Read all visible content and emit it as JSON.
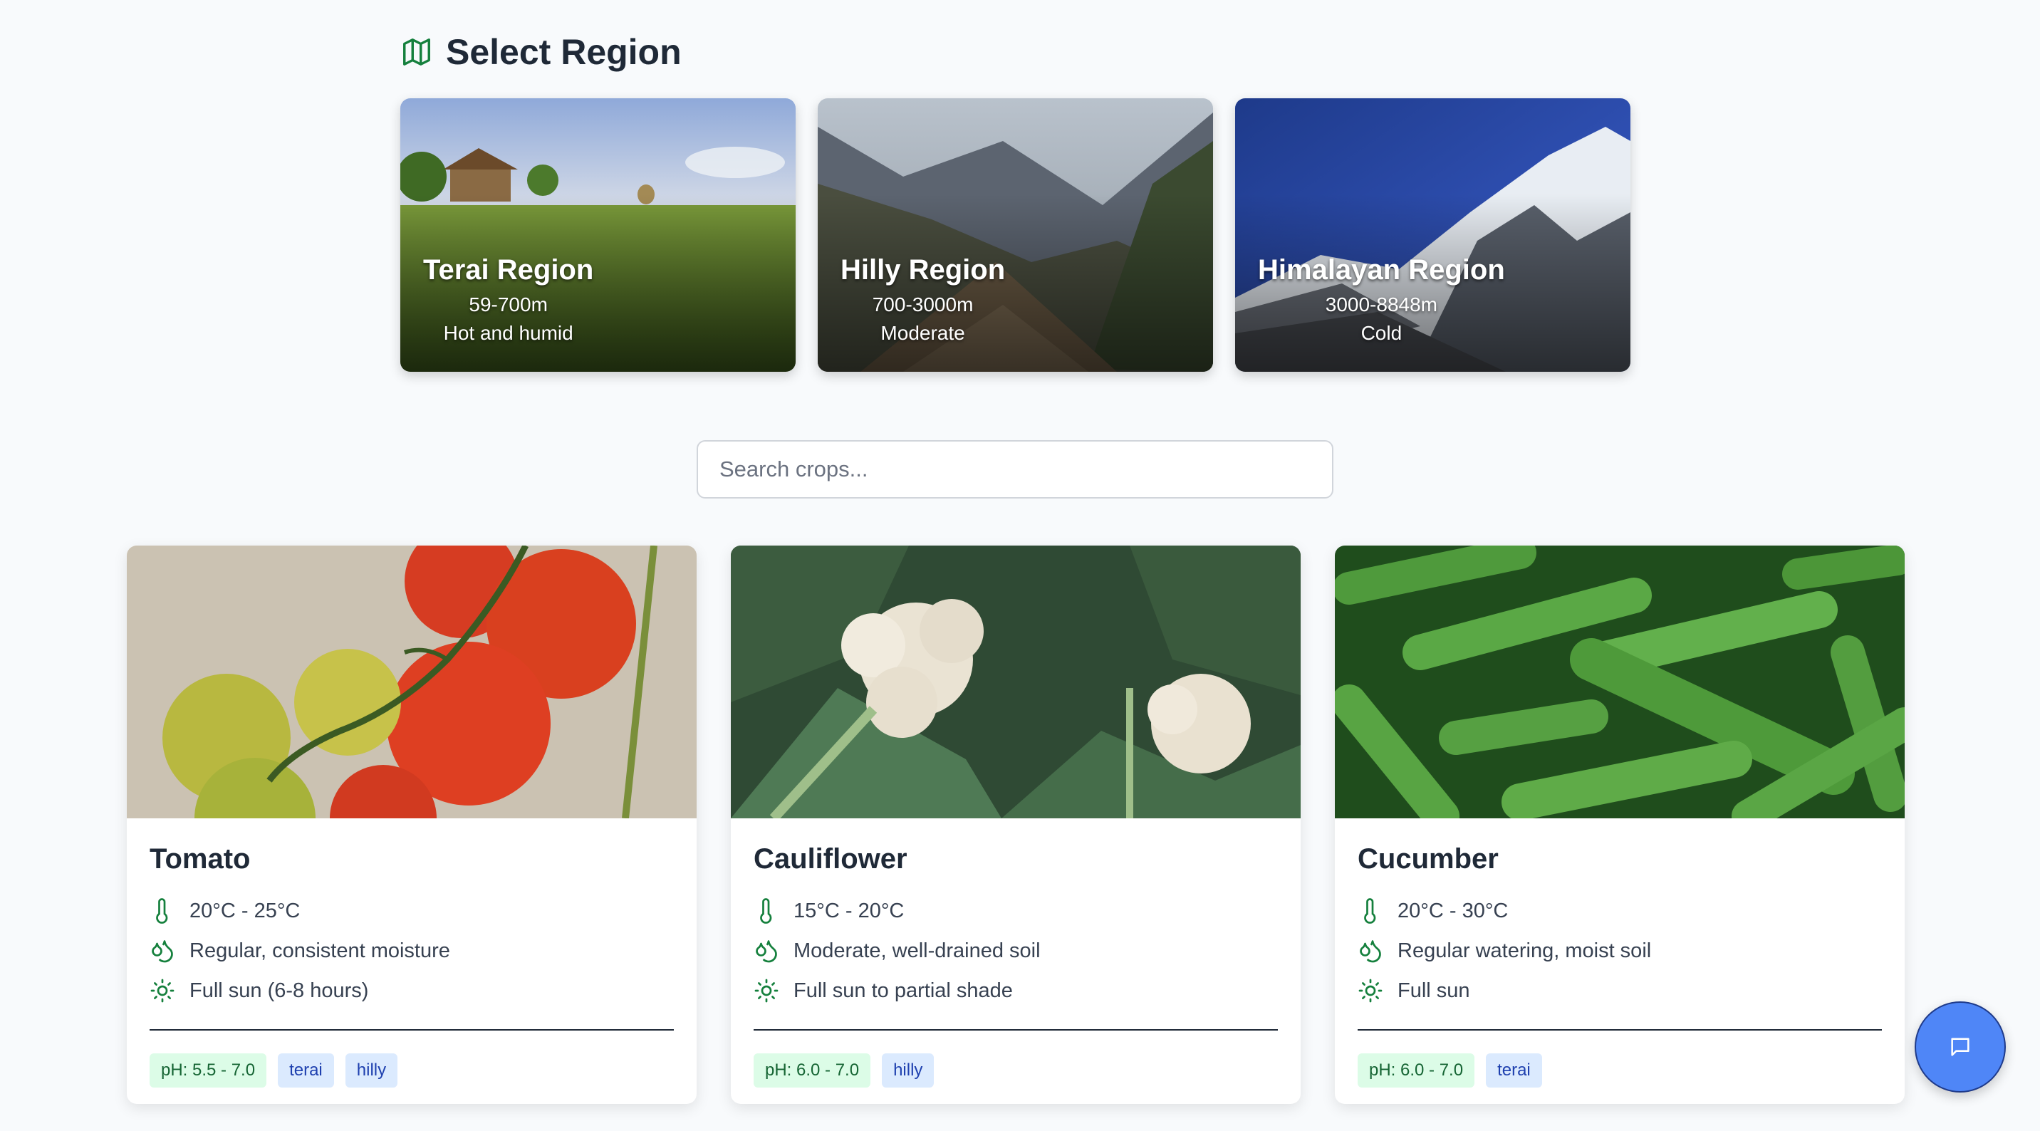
{
  "header": {
    "title": "Select Region",
    "icon": "map-icon"
  },
  "regions": [
    {
      "name": "Terai Region",
      "altitude": "59-700m",
      "climate": "Hot and humid"
    },
    {
      "name": "Hilly Region",
      "altitude": "700-3000m",
      "climate": "Moderate"
    },
    {
      "name": "Himalayan Region",
      "altitude": "3000-8848m",
      "climate": "Cold"
    }
  ],
  "search": {
    "placeholder": "Search crops...",
    "value": ""
  },
  "crops": [
    {
      "name": "Tomato",
      "temperature": "20°C - 25°C",
      "water": "Regular, consistent moisture",
      "sunlight": "Full sun (6-8 hours)",
      "ph": "pH: 5.5 - 7.0",
      "regions": [
        "terai",
        "hilly"
      ]
    },
    {
      "name": "Cauliflower",
      "temperature": "15°C - 20°C",
      "water": "Moderate, well-drained soil",
      "sunlight": "Full sun to partial shade",
      "ph": "pH: 6.0 - 7.0",
      "regions": [
        "hilly"
      ]
    },
    {
      "name": "Cucumber",
      "temperature": "20°C - 30°C",
      "water": "Regular watering, moist soil",
      "sunlight": "Full sun",
      "ph": "pH: 6.0 - 7.0",
      "regions": [
        "terai"
      ]
    }
  ],
  "chat": {
    "icon": "chat-icon"
  },
  "colors": {
    "accent": "#15803d",
    "chat": "#4f86f7",
    "ph_bg": "#dcfce7",
    "region_bg": "#dbeafe"
  }
}
